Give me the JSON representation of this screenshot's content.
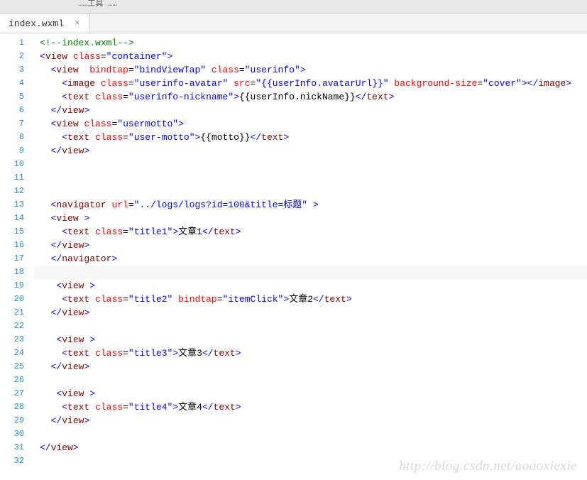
{
  "header": {
    "title_fragment": "……工具 ……"
  },
  "tab": {
    "label": "index.wxml",
    "close": "×"
  },
  "gutter": {
    "count": 32
  },
  "code_lines": [
    {
      "indent": 0,
      "tokens": [
        {
          "c": "p-comment",
          "t": "<!--index.wxml-->"
        }
      ]
    },
    {
      "indent": 0,
      "tokens": [
        {
          "c": "p-bracket",
          "t": "<"
        },
        {
          "c": "p-tag",
          "t": "view"
        },
        {
          "c": "",
          "t": " "
        },
        {
          "c": "p-attr",
          "t": "class"
        },
        {
          "c": "p-eq",
          "t": "="
        },
        {
          "c": "p-str",
          "t": "\"container\""
        },
        {
          "c": "p-bracket",
          "t": ">"
        }
      ]
    },
    {
      "indent": 1,
      "tokens": [
        {
          "c": "p-bracket",
          "t": "<"
        },
        {
          "c": "p-tag",
          "t": "view"
        },
        {
          "c": "",
          "t": "  "
        },
        {
          "c": "p-attr",
          "t": "bindtap"
        },
        {
          "c": "p-eq",
          "t": "="
        },
        {
          "c": "p-str",
          "t": "\"bindViewTap\""
        },
        {
          "c": "",
          "t": " "
        },
        {
          "c": "p-attr",
          "t": "class"
        },
        {
          "c": "p-eq",
          "t": "="
        },
        {
          "c": "p-str",
          "t": "\"userinfo\""
        },
        {
          "c": "p-bracket",
          "t": ">"
        }
      ]
    },
    {
      "indent": 2,
      "tokens": [
        {
          "c": "p-bracket",
          "t": "<"
        },
        {
          "c": "p-tag",
          "t": "image"
        },
        {
          "c": "",
          "t": " "
        },
        {
          "c": "p-attr",
          "t": "class"
        },
        {
          "c": "p-eq",
          "t": "="
        },
        {
          "c": "p-str",
          "t": "\"userinfo-avatar\""
        },
        {
          "c": "",
          "t": " "
        },
        {
          "c": "p-attr",
          "t": "src"
        },
        {
          "c": "p-eq",
          "t": "="
        },
        {
          "c": "p-str",
          "t": "\"{{userInfo.avatarUrl}}\""
        },
        {
          "c": "",
          "t": " "
        },
        {
          "c": "p-attr",
          "t": "background-size"
        },
        {
          "c": "p-eq",
          "t": "="
        },
        {
          "c": "p-str",
          "t": "\"cover\""
        },
        {
          "c": "p-bracket",
          "t": "></"
        },
        {
          "c": "p-tag",
          "t": "image"
        },
        {
          "c": "p-bracket",
          "t": ">"
        }
      ]
    },
    {
      "indent": 2,
      "tokens": [
        {
          "c": "p-bracket",
          "t": "<"
        },
        {
          "c": "p-tag",
          "t": "text"
        },
        {
          "c": "",
          "t": " "
        },
        {
          "c": "p-attr",
          "t": "class"
        },
        {
          "c": "p-eq",
          "t": "="
        },
        {
          "c": "p-str",
          "t": "\"userinfo-nickname\""
        },
        {
          "c": "p-bracket",
          "t": ">"
        },
        {
          "c": "p-text",
          "t": "{{userInfo.nickName}}"
        },
        {
          "c": "p-bracket",
          "t": "</"
        },
        {
          "c": "p-tag",
          "t": "text"
        },
        {
          "c": "p-bracket",
          "t": ">"
        }
      ]
    },
    {
      "indent": 1,
      "tokens": [
        {
          "c": "p-bracket",
          "t": "</"
        },
        {
          "c": "p-tag",
          "t": "view"
        },
        {
          "c": "p-bracket",
          "t": ">"
        }
      ]
    },
    {
      "indent": 1,
      "tokens": [
        {
          "c": "p-bracket",
          "t": "<"
        },
        {
          "c": "p-tag",
          "t": "view"
        },
        {
          "c": "",
          "t": " "
        },
        {
          "c": "p-attr",
          "t": "class"
        },
        {
          "c": "p-eq",
          "t": "="
        },
        {
          "c": "p-str",
          "t": "\"usermotto\""
        },
        {
          "c": "p-bracket",
          "t": ">"
        }
      ]
    },
    {
      "indent": 2,
      "tokens": [
        {
          "c": "p-bracket",
          "t": "<"
        },
        {
          "c": "p-tag",
          "t": "text"
        },
        {
          "c": "",
          "t": " "
        },
        {
          "c": "p-attr",
          "t": "class"
        },
        {
          "c": "p-eq",
          "t": "="
        },
        {
          "c": "p-str",
          "t": "\"user-motto\""
        },
        {
          "c": "p-bracket",
          "t": ">"
        },
        {
          "c": "p-text",
          "t": "{{motto}}"
        },
        {
          "c": "p-bracket",
          "t": "</"
        },
        {
          "c": "p-tag",
          "t": "text"
        },
        {
          "c": "p-bracket",
          "t": ">"
        }
      ]
    },
    {
      "indent": 1,
      "tokens": [
        {
          "c": "p-bracket",
          "t": "</"
        },
        {
          "c": "p-tag",
          "t": "view"
        },
        {
          "c": "p-bracket",
          "t": ">"
        }
      ]
    },
    {
      "indent": 0,
      "tokens": []
    },
    {
      "indent": 0,
      "tokens": []
    },
    {
      "indent": 0,
      "tokens": []
    },
    {
      "indent": 1,
      "tokens": [
        {
          "c": "p-bracket",
          "t": "<"
        },
        {
          "c": "p-tag",
          "t": "navigator"
        },
        {
          "c": "",
          "t": " "
        },
        {
          "c": "p-attr",
          "t": "url"
        },
        {
          "c": "p-eq",
          "t": "="
        },
        {
          "c": "p-str",
          "t": "\"../logs/logs?id=100&title=标题\""
        },
        {
          "c": "",
          "t": " "
        },
        {
          "c": "p-bracket",
          "t": ">"
        }
      ]
    },
    {
      "indent": 1,
      "tokens": [
        {
          "c": "p-bracket",
          "t": "<"
        },
        {
          "c": "p-tag",
          "t": "view"
        },
        {
          "c": "",
          "t": " "
        },
        {
          "c": "p-bracket",
          "t": ">"
        }
      ]
    },
    {
      "indent": 2,
      "tokens": [
        {
          "c": "p-bracket",
          "t": "<"
        },
        {
          "c": "p-tag",
          "t": "text"
        },
        {
          "c": "",
          "t": " "
        },
        {
          "c": "p-attr",
          "t": "class"
        },
        {
          "c": "p-eq",
          "t": "="
        },
        {
          "c": "p-str",
          "t": "\"title1\""
        },
        {
          "c": "p-bracket",
          "t": ">"
        },
        {
          "c": "p-text",
          "t": "文章1"
        },
        {
          "c": "p-bracket",
          "t": "</"
        },
        {
          "c": "p-tag",
          "t": "text"
        },
        {
          "c": "p-bracket",
          "t": ">"
        }
      ]
    },
    {
      "indent": 1,
      "tokens": [
        {
          "c": "p-bracket",
          "t": "</"
        },
        {
          "c": "p-tag",
          "t": "view"
        },
        {
          "c": "p-bracket",
          "t": ">"
        }
      ]
    },
    {
      "indent": 1,
      "tokens": [
        {
          "c": "p-bracket",
          "t": "</"
        },
        {
          "c": "p-tag",
          "t": "navigator"
        },
        {
          "c": "p-bracket",
          "t": ">"
        }
      ]
    },
    {
      "indent": 0,
      "hl": true,
      "tokens": []
    },
    {
      "indent": 1,
      "tokens": [
        {
          "c": "",
          "t": " "
        },
        {
          "c": "p-bracket",
          "t": "<"
        },
        {
          "c": "p-tag",
          "t": "view"
        },
        {
          "c": "",
          "t": " "
        },
        {
          "c": "p-bracket",
          "t": ">"
        }
      ]
    },
    {
      "indent": 2,
      "tokens": [
        {
          "c": "p-bracket",
          "t": "<"
        },
        {
          "c": "p-tag",
          "t": "text"
        },
        {
          "c": "",
          "t": " "
        },
        {
          "c": "p-attr",
          "t": "class"
        },
        {
          "c": "p-eq",
          "t": "="
        },
        {
          "c": "p-str",
          "t": "\"title2\""
        },
        {
          "c": "",
          "t": " "
        },
        {
          "c": "p-attr",
          "t": "bindtap"
        },
        {
          "c": "p-eq",
          "t": "="
        },
        {
          "c": "p-str",
          "t": "\"itemClick\""
        },
        {
          "c": "p-bracket",
          "t": ">"
        },
        {
          "c": "p-text",
          "t": "文章2"
        },
        {
          "c": "p-bracket",
          "t": "</"
        },
        {
          "c": "p-tag",
          "t": "text"
        },
        {
          "c": "p-bracket",
          "t": ">"
        }
      ]
    },
    {
      "indent": 1,
      "tokens": [
        {
          "c": "p-bracket",
          "t": "</"
        },
        {
          "c": "p-tag",
          "t": "view"
        },
        {
          "c": "p-bracket",
          "t": ">"
        }
      ]
    },
    {
      "indent": 0,
      "tokens": []
    },
    {
      "indent": 1,
      "tokens": [
        {
          "c": "",
          "t": " "
        },
        {
          "c": "p-bracket",
          "t": "<"
        },
        {
          "c": "p-tag",
          "t": "view"
        },
        {
          "c": "",
          "t": " "
        },
        {
          "c": "p-bracket",
          "t": ">"
        }
      ]
    },
    {
      "indent": 2,
      "tokens": [
        {
          "c": "p-bracket",
          "t": "<"
        },
        {
          "c": "p-tag",
          "t": "text"
        },
        {
          "c": "",
          "t": " "
        },
        {
          "c": "p-attr",
          "t": "class"
        },
        {
          "c": "p-eq",
          "t": "="
        },
        {
          "c": "p-str",
          "t": "\"title3\""
        },
        {
          "c": "p-bracket",
          "t": ">"
        },
        {
          "c": "p-text",
          "t": "文章3"
        },
        {
          "c": "p-bracket",
          "t": "</"
        },
        {
          "c": "p-tag",
          "t": "text"
        },
        {
          "c": "p-bracket",
          "t": ">"
        }
      ]
    },
    {
      "indent": 1,
      "tokens": [
        {
          "c": "p-bracket",
          "t": "</"
        },
        {
          "c": "p-tag",
          "t": "view"
        },
        {
          "c": "p-bracket",
          "t": ">"
        }
      ]
    },
    {
      "indent": 0,
      "tokens": []
    },
    {
      "indent": 1,
      "tokens": [
        {
          "c": "",
          "t": " "
        },
        {
          "c": "p-bracket",
          "t": "<"
        },
        {
          "c": "p-tag",
          "t": "view"
        },
        {
          "c": "",
          "t": " "
        },
        {
          "c": "p-bracket",
          "t": ">"
        }
      ]
    },
    {
      "indent": 2,
      "tokens": [
        {
          "c": "p-bracket",
          "t": "<"
        },
        {
          "c": "p-tag",
          "t": "text"
        },
        {
          "c": "",
          "t": " "
        },
        {
          "c": "p-attr",
          "t": "class"
        },
        {
          "c": "p-eq",
          "t": "="
        },
        {
          "c": "p-str",
          "t": "\"title4\""
        },
        {
          "c": "p-bracket",
          "t": ">"
        },
        {
          "c": "p-text",
          "t": "文章4"
        },
        {
          "c": "p-bracket",
          "t": "</"
        },
        {
          "c": "p-tag",
          "t": "text"
        },
        {
          "c": "p-bracket",
          "t": ">"
        }
      ]
    },
    {
      "indent": 1,
      "tokens": [
        {
          "c": "p-bracket",
          "t": "</"
        },
        {
          "c": "p-tag",
          "t": "view"
        },
        {
          "c": "p-bracket",
          "t": ">"
        }
      ]
    },
    {
      "indent": 0,
      "tokens": []
    },
    {
      "indent": 0,
      "tokens": [
        {
          "c": "p-bracket",
          "t": "</"
        },
        {
          "c": "p-tag",
          "t": "view"
        },
        {
          "c": "p-bracket",
          "t": ">"
        }
      ]
    },
    {
      "indent": 0,
      "tokens": []
    }
  ],
  "watermark": "http://blog.csdn.net/aoaoxiexie"
}
